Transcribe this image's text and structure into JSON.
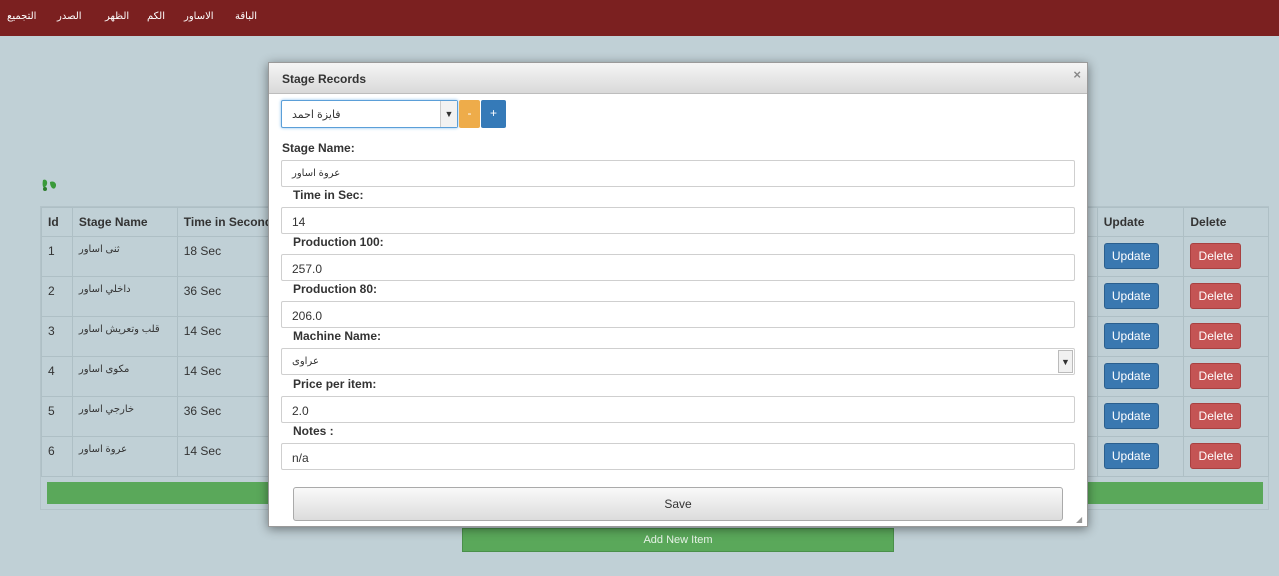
{
  "nav": {
    "items": [
      "الباقة",
      "الاساور",
      "الكم",
      "الظهر",
      "الصدر",
      "التجميع"
    ]
  },
  "table": {
    "headers": [
      "Id",
      "Stage Name",
      "Time in Seconds",
      "Update",
      "Delete"
    ],
    "rows": [
      {
        "id": "1",
        "stage": "ثنى اساور",
        "time": "18 Sec"
      },
      {
        "id": "2",
        "stage": "داخلي اساور",
        "time": "36 Sec"
      },
      {
        "id": "3",
        "stage": "قلب وتعريش اساور",
        "time": "14 Sec"
      },
      {
        "id": "4",
        "stage": "مكوى اساور",
        "time": "14 Sec"
      },
      {
        "id": "5",
        "stage": "خارجي اساور",
        "time": "36 Sec"
      },
      {
        "id": "6",
        "stage": "عروة اساور",
        "time": "14 Sec"
      }
    ],
    "update_label": "Update",
    "delete_label": "Delete",
    "add_label": "Add New Item"
  },
  "modal": {
    "title": "Stage Records",
    "close_symbol": "×",
    "worker_select": "فايزة احمد",
    "minus_label": "-",
    "plus_label": "+",
    "fields": {
      "stage_name": {
        "label": "Stage Name:",
        "value": "عروة اساور"
      },
      "time": {
        "label": "Time in Sec:",
        "value": "14"
      },
      "prod100": {
        "label": "Production 100:",
        "value": "257.0"
      },
      "prod80": {
        "label": "Production 80:",
        "value": "206.0"
      },
      "machine": {
        "label": "Machine Name:",
        "value": "عراوى"
      },
      "price": {
        "label": "Price per item:",
        "value": "2.0"
      },
      "notes": {
        "label": "Notes :",
        "value": "n/a"
      }
    },
    "save_label": "Save"
  },
  "colors": {
    "nav_bg": "#7b2020",
    "page_bg": "#c0d0d6",
    "update_btn": "#3a78b0",
    "delete_btn": "#c45454",
    "green": "#5aa85a",
    "minus_btn": "#eeac4a",
    "plus_btn": "#357ab8"
  }
}
